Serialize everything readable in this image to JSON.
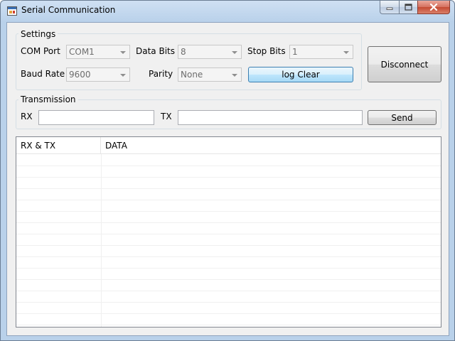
{
  "window": {
    "title": "Serial Communication",
    "icons": {
      "app": "app-window-icon",
      "minimize": "minimize-icon",
      "maximize": "maximize-icon",
      "close": "close-icon"
    }
  },
  "settings": {
    "group_label": "Settings",
    "com_port_label": "COM Port",
    "com_port_value": "COM1",
    "baud_rate_label": "Baud Rate",
    "baud_rate_value": "9600",
    "data_bits_label": "Data Bits",
    "data_bits_value": "8",
    "parity_label": "Parity",
    "parity_value": "None",
    "stop_bits_label": "Stop Bits",
    "stop_bits_value": "1",
    "log_clear_label": "log Clear"
  },
  "disconnect_label": "Disconnect",
  "transmission": {
    "group_label": "Transmission",
    "rx_label": "RX",
    "rx_value": "",
    "tx_label": "TX",
    "tx_value": "",
    "send_label": "Send"
  },
  "log_list": {
    "columns": [
      "RX & TX",
      "DATA"
    ],
    "rows": []
  }
}
